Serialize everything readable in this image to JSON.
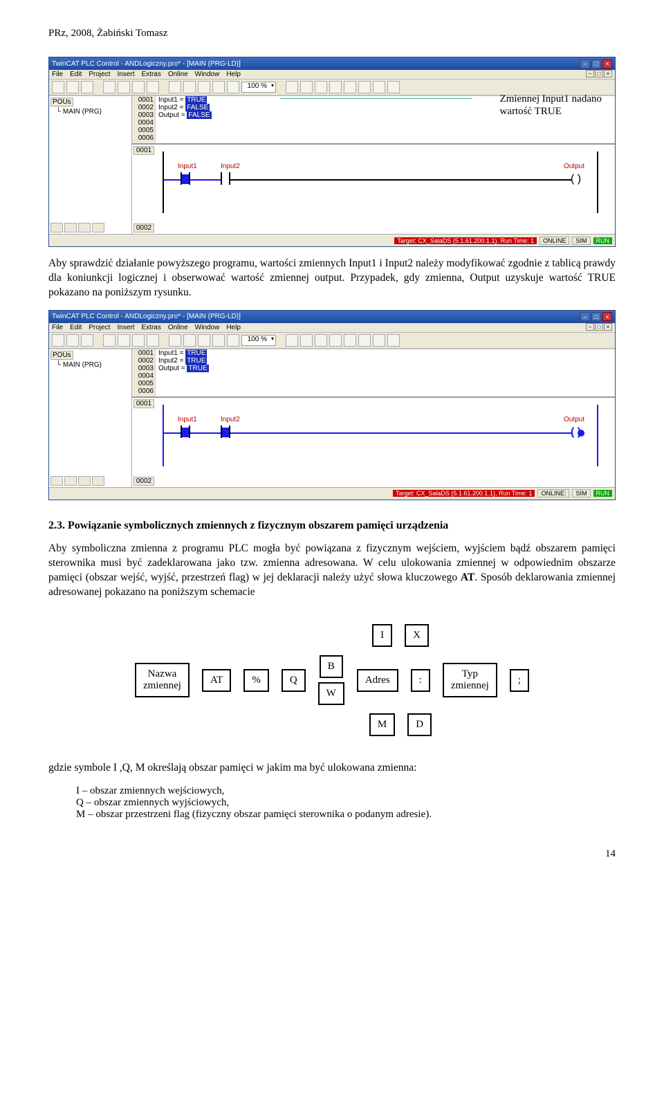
{
  "page": {
    "header": "PRz, 2008, Żabiński Tomasz",
    "number": "14"
  },
  "anno": {
    "line1": "Zmiennej Input1 nadano",
    "line2": "wartość TRUE"
  },
  "app1": {
    "title": "TwinCAT PLC Control - ANDLogiczny.pro* - [MAIN (PRG-LD)]",
    "menu": [
      "File",
      "Edit",
      "Project",
      "Insert",
      "Extras",
      "Online",
      "Window",
      "Help"
    ],
    "zoom": "100 %",
    "tree_tab": "POUs",
    "tree_item": "MAIN (PRG)",
    "lnums": [
      "0001",
      "0002",
      "0003",
      "0004",
      "0005",
      "0006"
    ],
    "vars": [
      {
        "name": "Input1 =",
        "val": "TRUE"
      },
      {
        "name": "Input2 =",
        "val": "FALSE"
      },
      {
        "name": "Output =",
        "val": "FALSE"
      }
    ],
    "lad_nums": [
      "0001",
      "0002"
    ],
    "labels": {
      "i1": "Input1",
      "i2": "Input2",
      "out": "Output"
    },
    "status_target": "Target: CX_SalaDS (5.1.61.200.1.1), Run Time: 1",
    "status_online": "ONLINE",
    "status_sim": "SIM",
    "status_run": "RUN"
  },
  "para1": "Aby sprawdzić działanie powyższego programu, wartości zmiennych Input1 i Input2 należy modyfikować zgodnie z tablicą prawdy dla koniunkcji logicznej i obserwować wartość zmiennej output. Przypadek, gdy zmienna, Output uzyskuje wartość TRUE pokazano na poniższym rysunku.",
  "app2": {
    "title": "TwinCAT PLC Control - ANDLogiczny.pro* - [MAIN (PRG-LD)]",
    "menu": [
      "File",
      "Edit",
      "Project",
      "Insert",
      "Extras",
      "Online",
      "Window",
      "Help"
    ],
    "zoom": "100 %",
    "tree_tab": "POUs",
    "tree_item": "MAIN (PRG)",
    "lnums": [
      "0001",
      "0002",
      "0003",
      "0004",
      "0005",
      "0006"
    ],
    "vars": [
      {
        "name": "Input1 =",
        "val": "TRUE"
      },
      {
        "name": "Input2 =",
        "val": "TRUE"
      },
      {
        "name": "Output =",
        "val": "TRUE"
      }
    ],
    "lad_nums": [
      "0001",
      "0002"
    ],
    "labels": {
      "i1": "Input1",
      "i2": "Input2",
      "out": "Output"
    },
    "status_target": "Target: CX_SalaDS (5.1.61.200.1.1), Run Time: 1",
    "status_online": "ONLINE:",
    "status_sim": "SIM",
    "status_run": "RUN"
  },
  "section_title": "2.3. Powiązanie symbolicznych zmiennych z fizycznym obszarem pamięci urządzenia",
  "para2_1": "Aby symboliczna zmienna z programu PLC mogła być powiązana z fizycznym wejściem, wyjściem bądź obszarem pamięci sterownika musi być zadeklarowana jako tzw. zmienna adresowana. W celu ulokowania zmiennej w odpowiednim obszarze pamięci (obszar wejść, wyjść, przestrzeń flag) w jej deklaracji należy użyć słowa kluczowego ",
  "para2_at": "AT",
  "para2_2": ". Sposób deklarowania zmiennej adresowanej pokazano na poniższym schemacie",
  "schema": {
    "nazwa": "Nazwa\nzmiennej",
    "at": "AT",
    "pct": "%",
    "I": "I",
    "Q": "Q",
    "M": "M",
    "X": "X",
    "B": "B",
    "W": "W",
    "D": "D",
    "adres": "Adres",
    "colon": ":",
    "typ": "Typ\nzmiennej",
    "semi": ";"
  },
  "para3_intro": "gdzie symbole I ,Q, M określają obszar pamięci w jakim ma być ulokowana zmienna:",
  "li1": "I – obszar zmiennych wejściowych,",
  "li2": "Q – obszar zmiennych wyjściowych,",
  "li3": "M – obszar przestrzeni flag (fizyczny obszar pamięci sterownika o podanym adresie)."
}
